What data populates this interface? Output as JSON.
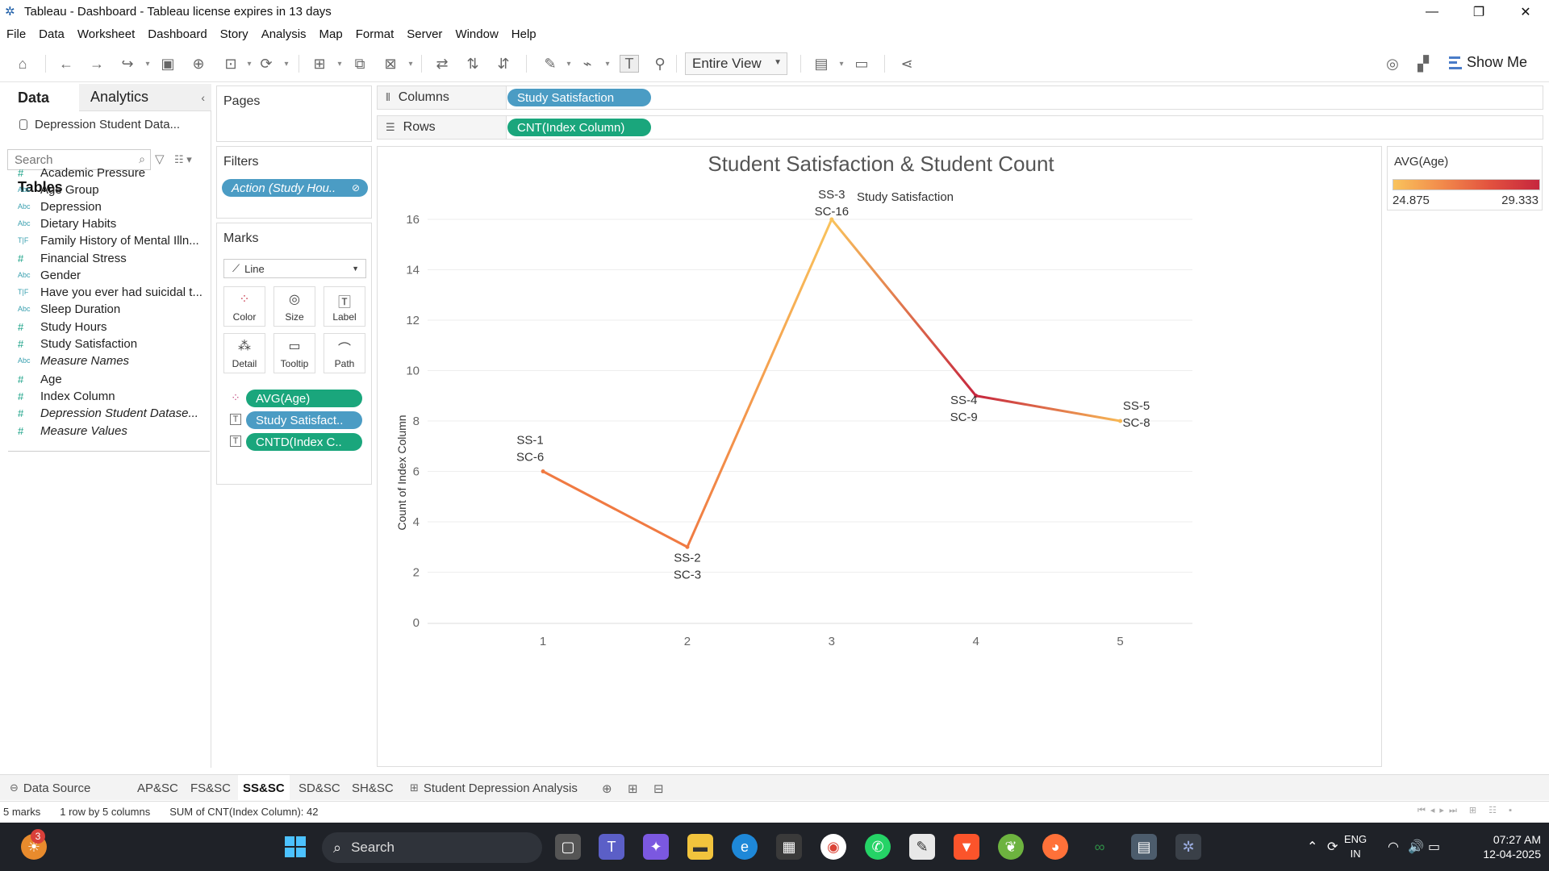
{
  "window": {
    "title": "Tableau - Dashboard - Tableau license expires in 13 days",
    "minimize": "—",
    "restore": "❐",
    "close": "✕"
  },
  "menu": [
    "File",
    "Data",
    "Worksheet",
    "Dashboard",
    "Story",
    "Analysis",
    "Map",
    "Format",
    "Server",
    "Window",
    "Help"
  ],
  "toolbar": {
    "fit_value": "Entire View",
    "show_me": "Show Me"
  },
  "data_pane": {
    "tab_data": "Data",
    "tab_analytics": "Analytics",
    "datasource": "Depression Student Data...",
    "search_placeholder": "Search",
    "tables_heading": "Tables",
    "dimensions": [
      {
        "type": "#",
        "name": "Academic Pressure"
      },
      {
        "type": "Abc",
        "name": "Age Group"
      },
      {
        "type": "Abc",
        "name": "Depression"
      },
      {
        "type": "Abc",
        "name": "Dietary Habits"
      },
      {
        "type": "T|F",
        "name": "Family History of Mental Illn..."
      },
      {
        "type": "#",
        "name": "Financial Stress"
      },
      {
        "type": "Abc",
        "name": "Gender"
      },
      {
        "type": "T|F",
        "name": "Have you ever had suicidal t..."
      },
      {
        "type": "Abc",
        "name": "Sleep Duration"
      },
      {
        "type": "#",
        "name": "Study Hours"
      },
      {
        "type": "#",
        "name": "Study Satisfaction"
      },
      {
        "type": "Abc",
        "name": "Measure Names"
      }
    ],
    "measures": [
      {
        "type": "#",
        "name": "Age"
      },
      {
        "type": "#",
        "name": "Index Column"
      },
      {
        "type": "#",
        "name": "Depression Student Datase..."
      },
      {
        "type": "#",
        "name": "Measure Values"
      }
    ]
  },
  "cards": {
    "pages": "Pages",
    "filters": "Filters",
    "filter_pill": "Action (Study Hou..",
    "marks": "Marks",
    "mark_type": "Line",
    "mark_buttons": [
      "Color",
      "Size",
      "Label",
      "Detail",
      "Tooltip",
      "Path"
    ],
    "mark_pills": [
      "AVG(Age)",
      "Study Satisfact..",
      "CNTD(Index C.."
    ]
  },
  "shelves": {
    "columns_label": "Columns",
    "columns_pill": "Study Satisfaction",
    "rows_label": "Rows",
    "rows_pill": "CNT(Index Column)"
  },
  "legend": {
    "title": "AVG(Age)",
    "min": "24.875",
    "max": "29.333"
  },
  "chart_data": {
    "type": "line",
    "title": "Student Satisfaction & Student Count",
    "header": "Study Satisfaction",
    "ylabel": "Count of Index Column",
    "x": [
      1,
      2,
      3,
      4,
      5
    ],
    "x_ticks": [
      "1",
      "2",
      "3",
      "4",
      "5"
    ],
    "y_ticks": [
      0,
      2,
      4,
      6,
      8,
      10,
      12,
      14,
      16
    ],
    "ylim": [
      0,
      16
    ],
    "series": [
      {
        "values": [
          6,
          3,
          16,
          9,
          8
        ]
      }
    ],
    "labels": [
      [
        "SS-1",
        "SC-6"
      ],
      [
        "SS-2",
        "SC-3"
      ],
      [
        "SS-3",
        "SC-16"
      ],
      [
        "SS-4",
        "SC-9"
      ],
      [
        "SS-5",
        "SC-8"
      ]
    ],
    "point_colors": [
      "#f07a42",
      "#f07a42",
      "#f9c35c",
      "#c6263e",
      "#f7b855"
    ],
    "grid": true
  },
  "sheet_tabs": {
    "data_source": "Data Source",
    "sheets": [
      "AP&SC",
      "FS&SC",
      "SS&SC",
      "SD&SC",
      "SH&SC"
    ],
    "active": "SS&SC",
    "dashboard": "Student Depression Analysis"
  },
  "status": {
    "marks": "5 marks",
    "rows_cols": "1 row by 5 columns",
    "sum": "SUM of CNT(Index Column): 42"
  },
  "taskbar": {
    "search": "Search",
    "badge": "3",
    "lang1": "ENG",
    "lang2": "IN",
    "time": "07:27 AM",
    "date": "12-04-2025"
  }
}
